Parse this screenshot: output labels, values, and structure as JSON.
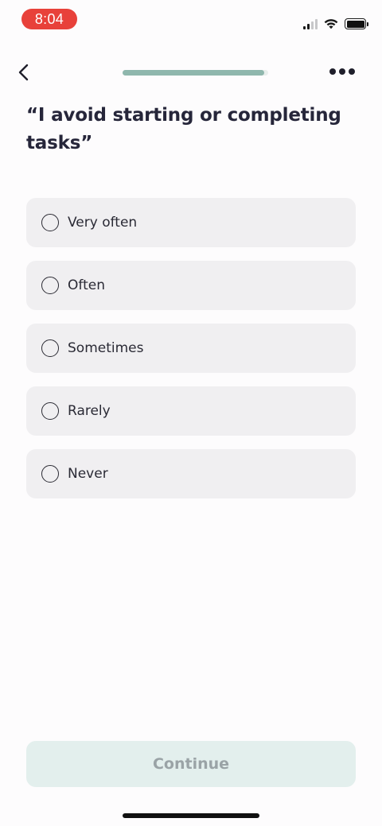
{
  "status_bar": {
    "time": "8:04",
    "icons": [
      "cellular-signal-icon",
      "wifi-icon",
      "battery-icon"
    ]
  },
  "nav": {
    "back_icon": "chevron-left-icon",
    "more_icon": "ellipsis-icon",
    "progress": 0.97
  },
  "question": {
    "text": "“I avoid starting or completing tasks”"
  },
  "options": [
    {
      "label": "Very often",
      "selected": false
    },
    {
      "label": "Often",
      "selected": false
    },
    {
      "label": "Sometimes",
      "selected": false
    },
    {
      "label": "Rarely",
      "selected": false
    },
    {
      "label": "Never",
      "selected": false
    }
  ],
  "continue_button": {
    "label": "Continue",
    "enabled": false
  },
  "colors": {
    "accent": "#8fb7ad",
    "time_pill": "#e8413a",
    "option_bg": "#f0eff1",
    "continue_bg": "#e3efed",
    "continue_text": "#9aa3a6",
    "title_text": "#26263a"
  }
}
